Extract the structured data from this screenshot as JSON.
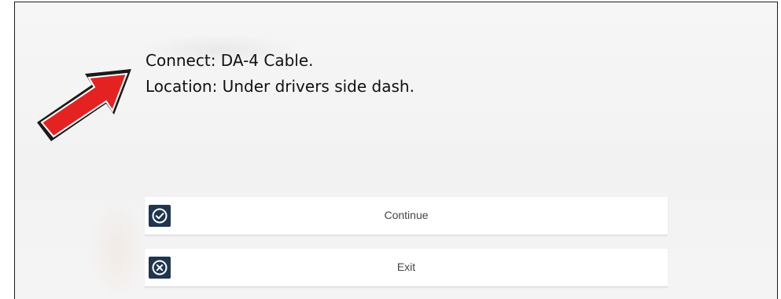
{
  "message": {
    "line1": "Connect: DA-4 Cable.",
    "line2": "Location: Under drivers side dash."
  },
  "buttons": {
    "continue": {
      "label": "Continue",
      "icon": "check-circle-icon"
    },
    "exit": {
      "label": "Exit",
      "icon": "x-circle-icon"
    }
  },
  "colors": {
    "arrow": "#e52222",
    "icon_bg": "#1f3550"
  }
}
